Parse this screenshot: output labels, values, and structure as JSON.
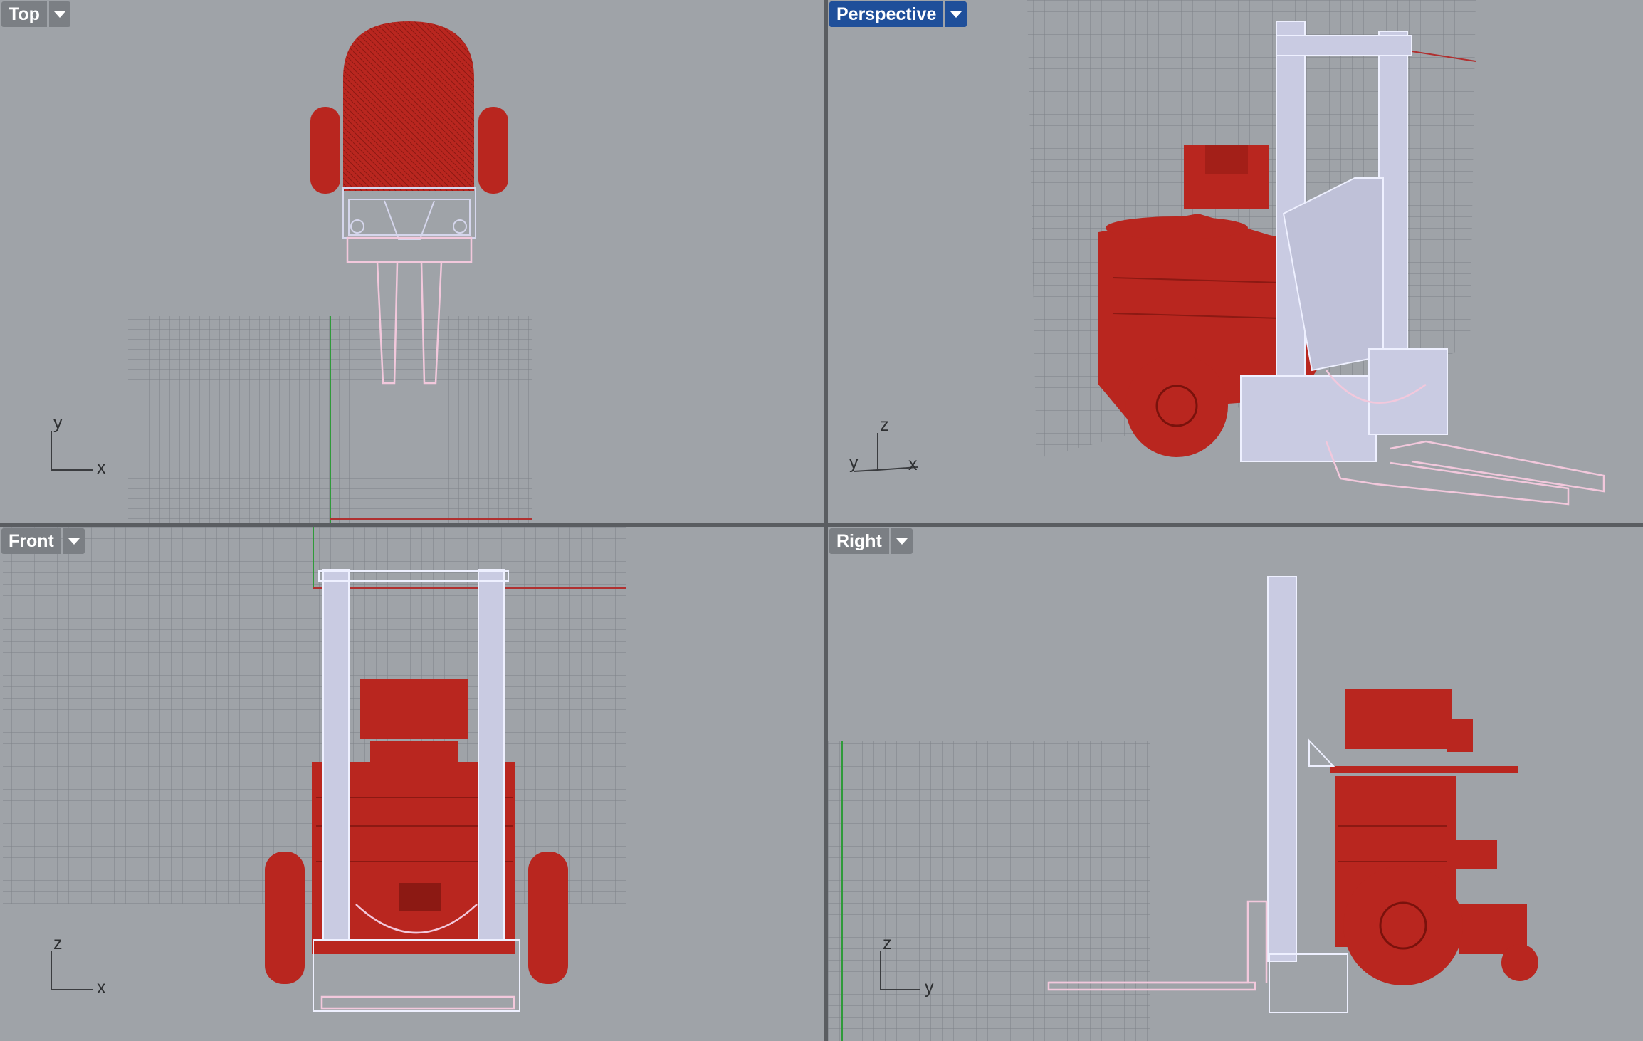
{
  "viewports": {
    "top": {
      "title": "Top",
      "axes": {
        "first": "x",
        "second": "y"
      }
    },
    "perspective": {
      "title": "Perspective",
      "active": true,
      "axes": {
        "first": "x",
        "second": "z",
        "third": "y"
      }
    },
    "front": {
      "title": "Front",
      "axes": {
        "first": "x",
        "second": "z"
      }
    },
    "right": {
      "title": "Right",
      "axes": {
        "first": "y",
        "second": "z"
      }
    }
  },
  "colors": {
    "viewport_background": "#9fa3a8",
    "divider": "#5a5d61",
    "active_tab": "#1f4f9a",
    "inactive_tab": "#7b7f84",
    "robot_red": "#b9261f",
    "frame_lavender": "#d5d6ec",
    "fork_pink": "#f2c8dc",
    "x_axis_line": "#b03030",
    "y_axis_line": "#2f9a3a"
  },
  "icons": {
    "menu": "dropdown-arrow-icon"
  }
}
